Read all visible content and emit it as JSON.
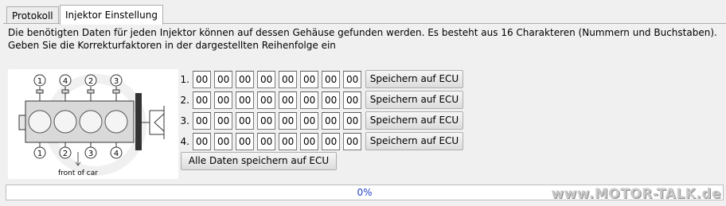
{
  "tabs": [
    {
      "label": "Protokoll",
      "active": false
    },
    {
      "label": "Injektor Einstellung",
      "active": true
    }
  ],
  "description": {
    "line1": "Die benötigten Daten für jeden Injektor können auf dessen Gehäuse gefunden werden. Es besteht aus 16 Charakteren (Nummern und Buchstaben).",
    "line2": "Geben Sie die Korrekturfaktoren in der dargestellten Reihenfolge ein"
  },
  "diagram": {
    "top_labels": [
      "1",
      "4",
      "2",
      "3"
    ],
    "bottom_labels": [
      "1",
      "2",
      "3",
      "4"
    ],
    "front_label": "front of car"
  },
  "injectors": [
    {
      "number": "1.",
      "values": [
        "00",
        "00",
        "00",
        "00",
        "00",
        "00",
        "00",
        "00"
      ],
      "save_label": "Speichern auf ECU"
    },
    {
      "number": "2.",
      "values": [
        "00",
        "00",
        "00",
        "00",
        "00",
        "00",
        "00",
        "00"
      ],
      "save_label": "Speichern auf ECU"
    },
    {
      "number": "3.",
      "values": [
        "00",
        "00",
        "00",
        "00",
        "00",
        "00",
        "00",
        "00"
      ],
      "save_label": "Speichern auf ECU"
    },
    {
      "number": "4.",
      "values": [
        "00",
        "00",
        "00",
        "00",
        "00",
        "00",
        "00",
        "00"
      ],
      "save_label": "Speichern auf ECU"
    }
  ],
  "save_all_label": "Alle Daten speichern auf ECU",
  "progress": {
    "value": 0,
    "text": "0%"
  },
  "watermark": "www.MOTOR-TALK.de",
  "colors": {
    "progress_text": "#1f3fc8",
    "progress_fill": "#06b025"
  }
}
